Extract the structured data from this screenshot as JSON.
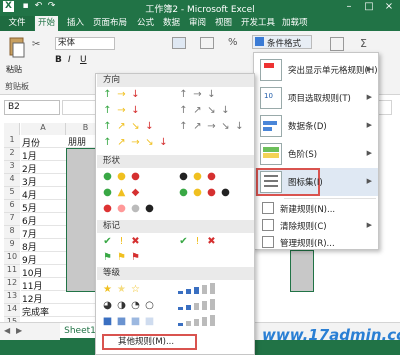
{
  "window": {
    "title": "工作簿2 - Microsoft Excel"
  },
  "tabs": [
    {
      "label": "文件"
    },
    {
      "label": "开始"
    },
    {
      "label": "插入"
    },
    {
      "label": "页面布局"
    },
    {
      "label": "公式"
    },
    {
      "label": "数据"
    },
    {
      "label": "审阅"
    },
    {
      "label": "视图"
    },
    {
      "label": "开发工具"
    },
    {
      "label": "加载项"
    }
  ],
  "ribbon": {
    "font_name": "宋体",
    "paste_label": "粘贴",
    "clipboard_label": "剪贴板",
    "conditional_format_label": "条件格式"
  },
  "formula_bar": {
    "name_box": "B2"
  },
  "sheet": {
    "col_b_header": "朋朋",
    "column_a": [
      "月份",
      "1月",
      "2月",
      "3月",
      "4月",
      "5月",
      "6月",
      "7月",
      "8月",
      "9月",
      "10月",
      "11月",
      "12月",
      "完成率"
    ],
    "row_numbers": [
      "1",
      "2",
      "3",
      "4",
      "5",
      "6",
      "7",
      "8",
      "9",
      "10",
      "11",
      "12",
      "13",
      "14",
      "15"
    ],
    "tab_name": "Sheet1"
  },
  "icon_menu": {
    "sections": {
      "direction": "方向",
      "shape": "形状",
      "indicator": "标记",
      "rating": "等级"
    },
    "more_rules": "其他规则(M)..."
  },
  "cf_menu": {
    "items": [
      {
        "label": "突出显示单元格规则(H)"
      },
      {
        "label": "项目选取规则(T)"
      },
      {
        "label": "数据条(D)"
      },
      {
        "label": "色阶(S)"
      },
      {
        "label": "图标集(I)"
      }
    ],
    "new_rule": "新建规则(N)...",
    "clear_rules": "清除规则(C)",
    "manage_rules": "管理规则(R)..."
  },
  "watermark": "www.17admin.cc",
  "colors": {
    "excel_green": "#217346",
    "highlight_red": "#d9534f",
    "green": "#39a845",
    "yellow": "#f0c020",
    "red": "#d53030"
  }
}
